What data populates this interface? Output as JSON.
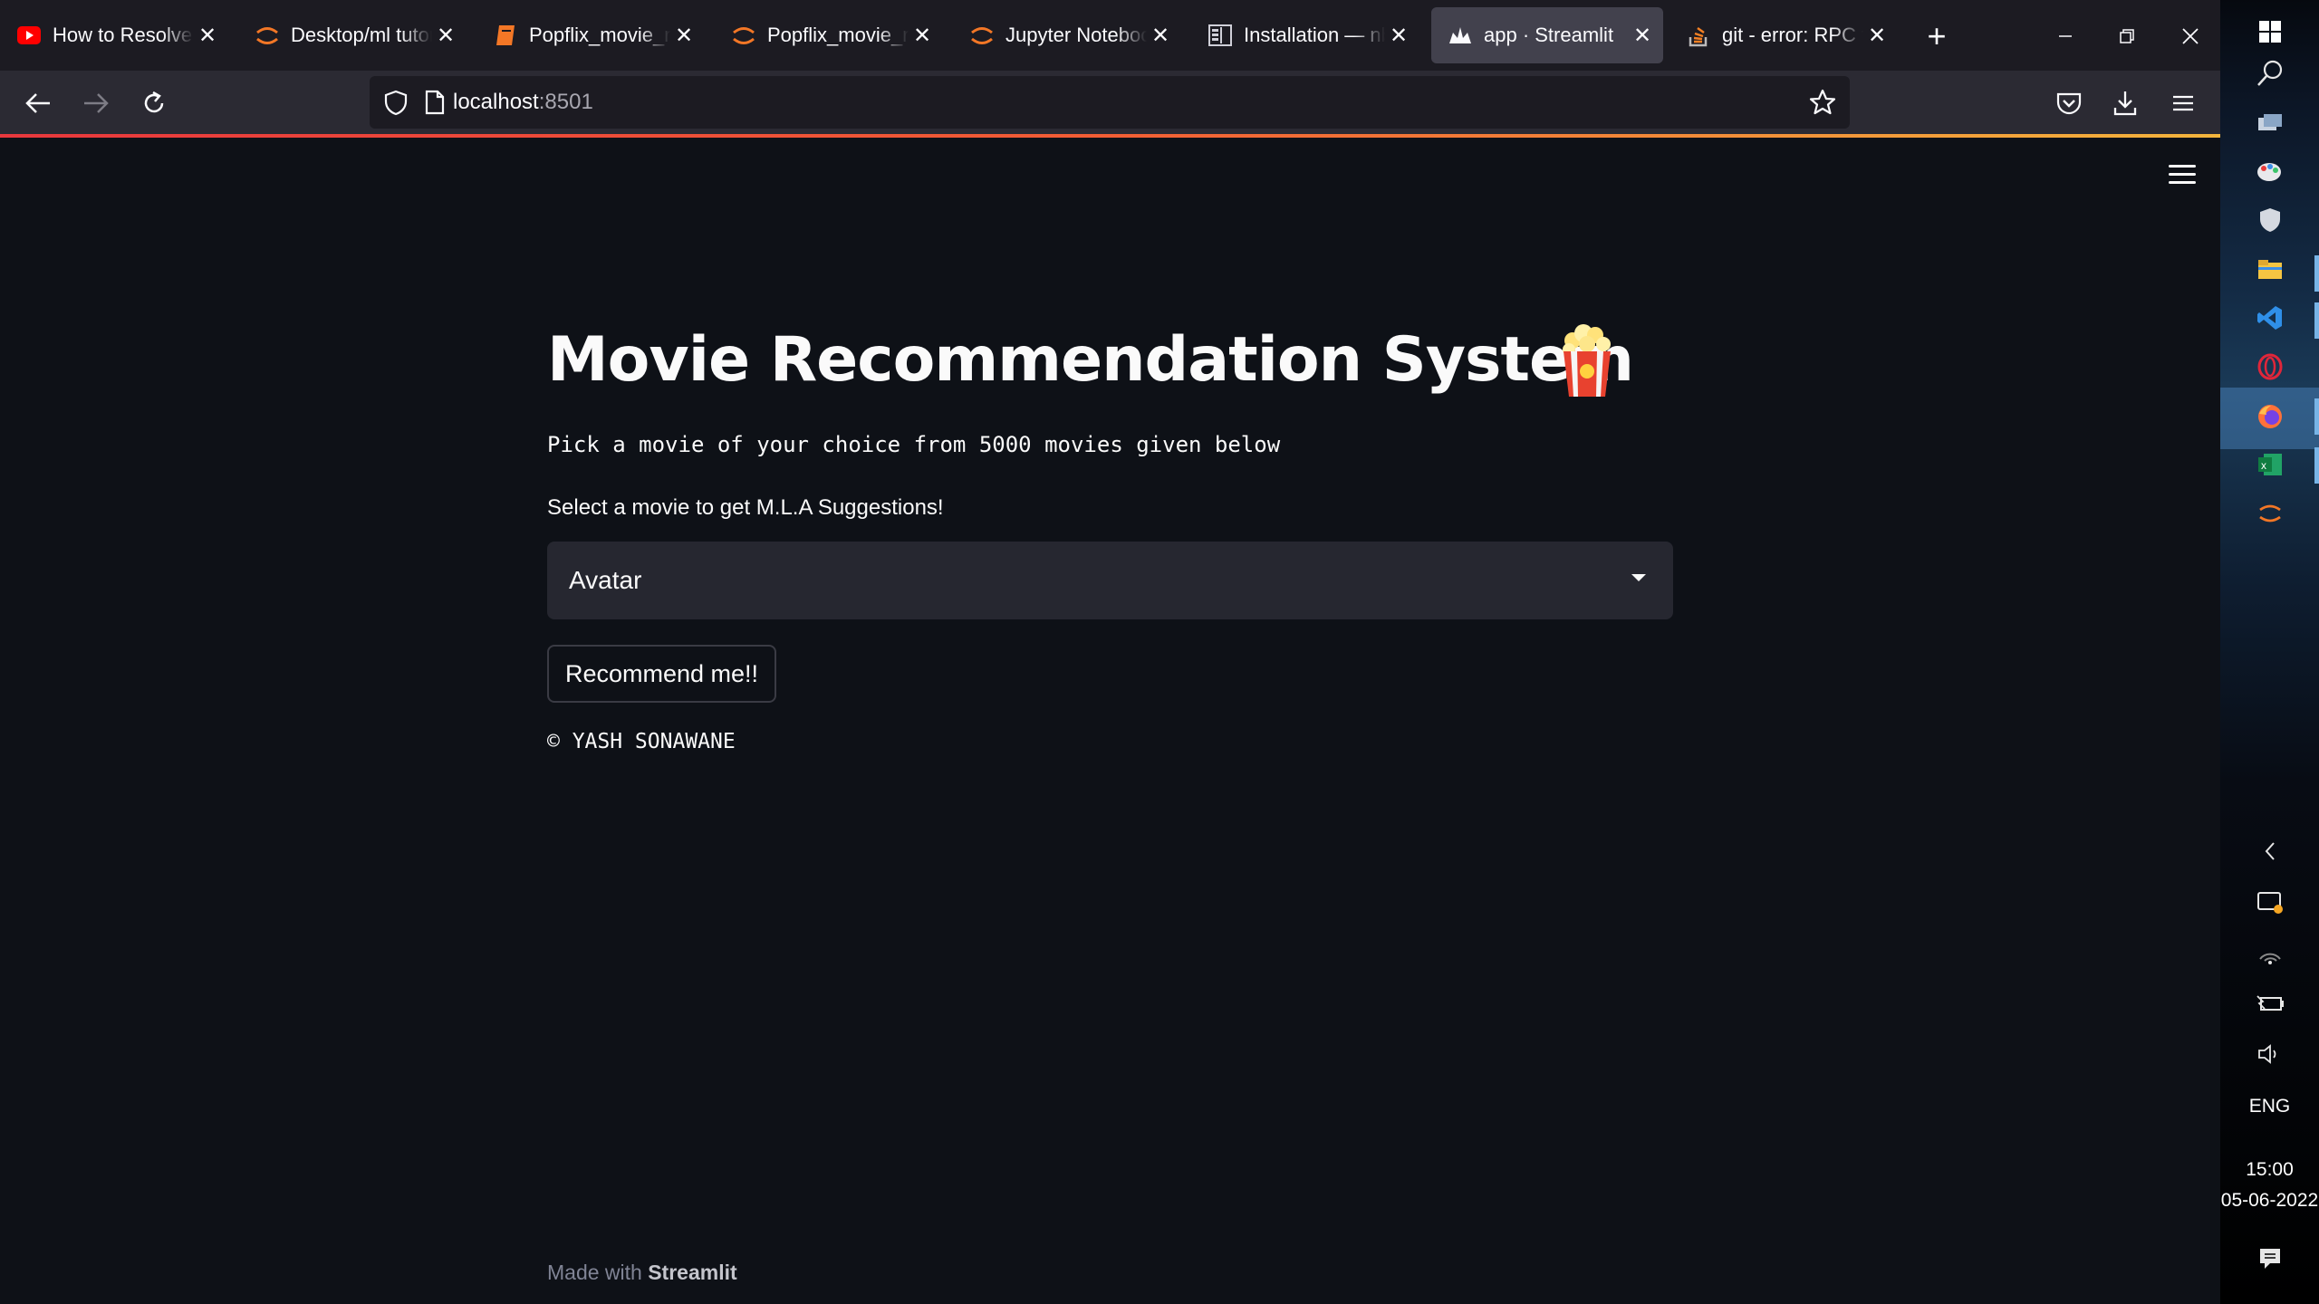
{
  "browser": {
    "tabs": [
      {
        "title": "How to Resolve \"ImportError\"",
        "icon": "youtube-icon",
        "color": "#ff0000"
      },
      {
        "title": "Desktop/ml tutorial",
        "icon": "jupyter-icon",
        "color": "#f37726"
      },
      {
        "title": "Popflix_movie_recommender",
        "icon": "notebook-icon",
        "color": "#f37726"
      },
      {
        "title": "Popflix_movie_recommender",
        "icon": "jupyter-icon",
        "color": "#f37726"
      },
      {
        "title": "Jupyter Notebook",
        "icon": "jupyter-icon",
        "color": "#f37726"
      },
      {
        "title": "Installation — nbextensions",
        "icon": "docs-icon",
        "color": "#cfcfd8"
      },
      {
        "title": "app · Streamlit",
        "icon": "streamlit-icon",
        "color": "#fbfbfe"
      },
      {
        "title": "git - error: RPC failed",
        "icon": "stackoverflow-icon",
        "color": "#f48024"
      }
    ],
    "url_host": "localhost",
    "url_port": ":8501"
  },
  "app": {
    "title": "Movie Recommendation System",
    "subtitle": "Pick a movie of your choice from 5000 movies given below",
    "select_label": "Select a movie to get M.L.A Suggestions!",
    "selected_movie": "Avatar",
    "button_label": "Recommend me!!",
    "copyright": "© YASH SONAWANE",
    "footer_prefix": "Made with ",
    "footer_brand": "Streamlit"
  },
  "taskbar": {
    "language": "ENG",
    "time": "15:00",
    "date": "05-06-2022"
  }
}
